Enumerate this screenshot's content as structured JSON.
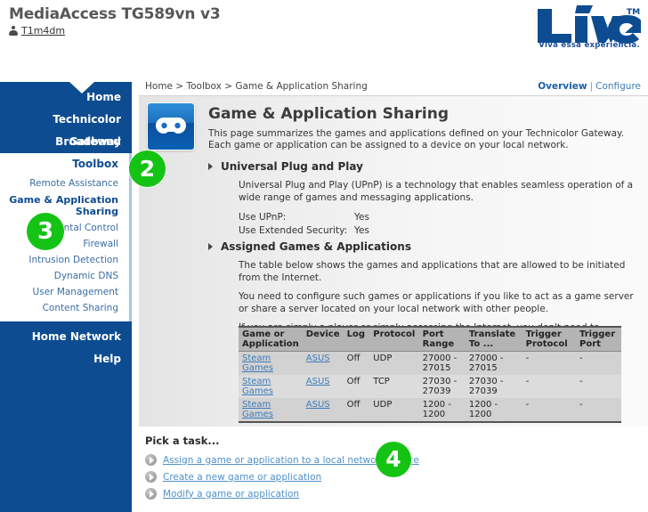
{
  "header": {
    "product_title": "MediaAccess TG589vn v3",
    "user_name": "T1m4dm",
    "user_icon": "user-icon",
    "brand_name": "LiVe",
    "brand_trademark": "TM",
    "brand_tagline": "Viva essa experiência.",
    "brand_color": "#1b4f9c"
  },
  "breadcrumb": "Home > Toolbox > Game & Application Sharing",
  "view_links": {
    "active": "Overview",
    "separator": "|",
    "link": "Configure"
  },
  "sidebar": {
    "top_items": [
      {
        "label": "Home"
      },
      {
        "label": "Technicolor Gateway"
      },
      {
        "label": "Broadband Connection"
      }
    ],
    "submenu_title": "Toolbox",
    "submenu_items": [
      {
        "label": "Remote Assistance",
        "active": false
      },
      {
        "label": "Game & Application Sharing",
        "active": true
      },
      {
        "label": "Parental Control",
        "active": false
      },
      {
        "label": "Firewall",
        "active": false
      },
      {
        "label": "Intrusion Detection",
        "active": false
      },
      {
        "label": "Dynamic DNS",
        "active": false
      },
      {
        "label": "User Management",
        "active": false
      },
      {
        "label": "Content Sharing",
        "active": false
      }
    ],
    "bottom_items": [
      {
        "label": "Home Network"
      },
      {
        "label": "Help"
      }
    ]
  },
  "page": {
    "icon": "gamepad-icon",
    "title": "Game & Application Sharing",
    "description": "This page summarizes the games and applications defined on your Technicolor Gateway. Each game or application can be assigned to a device on your local network."
  },
  "upnp_section": {
    "heading": "Universal Plug and Play",
    "body": "Universal Plug and Play (UPnP) is a technology that enables seamless operation of a wide range of games and messaging applications.",
    "fields": [
      {
        "label": "Use UPnP:",
        "value": "Yes"
      },
      {
        "label": "Use Extended Security:",
        "value": "Yes"
      }
    ]
  },
  "assigned_section": {
    "heading": "Assigned Games & Applications",
    "paragraphs": [
      "The table below shows the games and applications that are allowed to be initiated from the Internet.",
      "You need to configure such games or applications if you like to act as a game server or share a server located on your local network with other people.",
      "If you are simply a player or simply accessing the Internet, you don't need to configure games or applications."
    ]
  },
  "table": {
    "columns": [
      "Game or Application",
      "Device",
      "Log",
      "Protocol",
      "Port Range",
      "Translate To ...",
      "Trigger Protocol",
      "Trigger Port"
    ],
    "rows": [
      {
        "app": "Steam Games",
        "device": "ASUS",
        "log": "Off",
        "protocol": "UDP",
        "port_range": "27000 - 27015",
        "translate_to": "27000 - 27015",
        "trigger_protocol": "-",
        "trigger_port": "-"
      },
      {
        "app": "Steam Games",
        "device": "ASUS",
        "log": "Off",
        "protocol": "TCP",
        "port_range": "27030 - 27039",
        "translate_to": "27030 - 27039",
        "trigger_protocol": "-",
        "trigger_port": "-"
      },
      {
        "app": "Steam Games",
        "device": "ASUS",
        "log": "Off",
        "protocol": "UDP",
        "port_range": "1200 - 1200",
        "translate_to": "1200 - 1200",
        "trigger_protocol": "-",
        "trigger_port": "-"
      }
    ]
  },
  "tasks": {
    "title": "Pick a task...",
    "items": [
      {
        "label": "Assign a game or application to a local network device"
      },
      {
        "label": "Create a new game or application"
      },
      {
        "label": "Modify a game or application"
      }
    ]
  },
  "annotations": {
    "badge_color": "#15c315",
    "steps": [
      {
        "number": "2",
        "target": "toolbox-menu"
      },
      {
        "number": "3",
        "target": "game-application-sharing-menu"
      },
      {
        "number": "4",
        "target": "assign-game-task-link"
      }
    ]
  }
}
